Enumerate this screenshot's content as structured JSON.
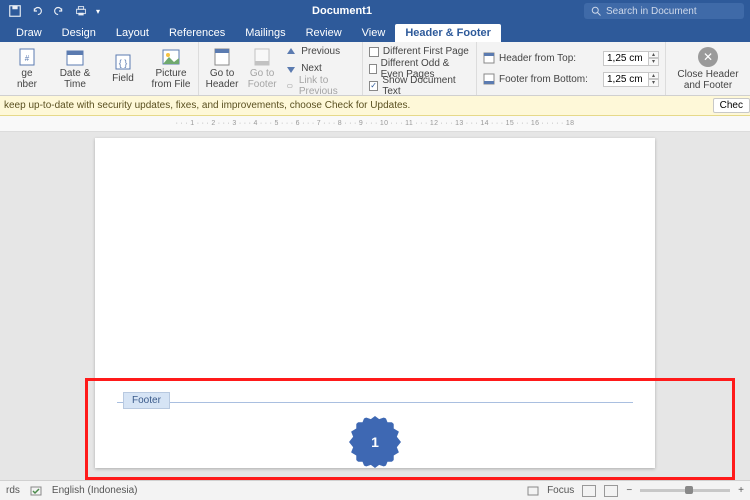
{
  "titlebar": {
    "title": "Document1",
    "search_placeholder": "Search in Document"
  },
  "tabs": [
    "Draw",
    "Design",
    "Layout",
    "References",
    "Mailings",
    "Review",
    "View",
    "Header & Footer"
  ],
  "active_tab": 7,
  "ribbon": {
    "pghdr": {
      "number_lbl": "ge\nnber",
      "date_lbl": "Date &\nTime",
      "field_lbl": "Field",
      "pic_lbl": "Picture\nfrom File"
    },
    "nav": {
      "gohdr": "Go to\nHeader",
      "goftr": "Go to\nFooter",
      "prev": "Previous",
      "next": "Next",
      "link": "Link to Previous"
    },
    "opts": {
      "diff_first": "Different First Page",
      "diff_oe": "Different Odd & Even Pages",
      "show_doc": "Show Document Text"
    },
    "pos": {
      "top_lbl": "Header from Top:",
      "top_val": "1,25 cm",
      "bot_lbl": "Footer from Bottom:",
      "bot_val": "1,25 cm"
    },
    "close": "Close Header\nand Footer"
  },
  "notice": {
    "text": "keep up-to-date with security updates, fixes, and improvements, choose Check for Updates.",
    "btn": "Chec"
  },
  "ruler": "· · · 1 · · · 2 · · · 3 · · · 4 · · · 5 · · · 6 · · · 7 · · · 8 · · · 9 · · · 10 · · · 11 · · · 12 · · · 13 · · · 14 · · · 15 · · · 16 · · · · · 18",
  "doc": {
    "footer_label": "Footer",
    "page_number": "1"
  },
  "status": {
    "words": "rds",
    "lang": "English (Indonesia)",
    "focus": "Focus"
  }
}
